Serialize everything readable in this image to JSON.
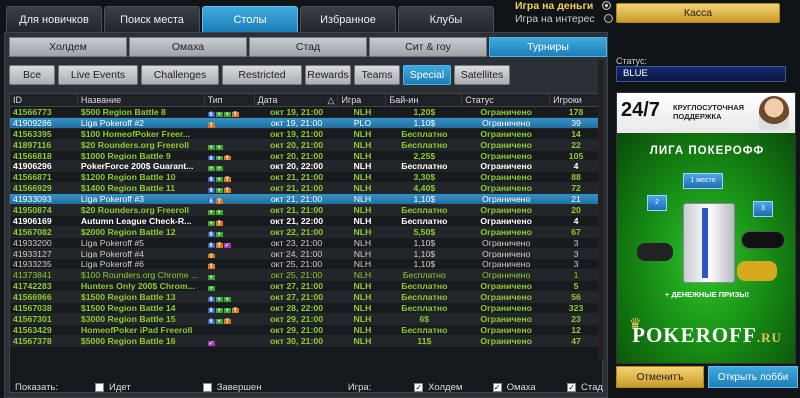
{
  "top_tabs": [
    "Для новичков",
    "Поиск места",
    "Столы",
    "Избранное",
    "Клубы"
  ],
  "active_top_tab": 2,
  "mode": {
    "real": "Игра на деньги",
    "play": "Игра на интерес"
  },
  "game_tabs": [
    "Холдем",
    "Омаха",
    "Стад",
    "Сит & гоу",
    "Турниры"
  ],
  "active_game_tab": 4,
  "filters": [
    "Все",
    "Live Events",
    "Challenges",
    "Restricted",
    "Rewards",
    "Teams",
    "Special",
    "Satellites"
  ],
  "active_filter": 6,
  "columns": {
    "id": "ID",
    "name": "Название",
    "type": "Тип",
    "date": "Дата",
    "sort": "△",
    "game": "Игра",
    "buyin": "Бай-ин",
    "status": "Статус",
    "players": "Игроки"
  },
  "rows": [
    {
      "id": "41566773",
      "name": "$500 Region Battle  8",
      "icons": "b g g o",
      "date": "окт 19, 21:00",
      "game": "NLH",
      "buyin": "1,20$",
      "status": "Ограничено",
      "players": "178",
      "style": "green"
    },
    {
      "id": "41909286",
      "name": "Liga Pokeroff #2",
      "icons": "o",
      "date": "окт 19, 21:00",
      "game": "PLO",
      "buyin": "1,10$",
      "status": "Ограничено",
      "players": "39",
      "style": "sel"
    },
    {
      "id": "41563395",
      "name": "$100 HomeofPoker Freer...",
      "icons": "",
      "date": "окт 19, 21:00",
      "game": "NLH",
      "buyin": "Бесплатно",
      "status": "Ограничено",
      "players": "14",
      "style": "green"
    },
    {
      "id": "41897116",
      "name": "$20 Rounders.org Freeroll",
      "icons": "g g",
      "date": "окт 20, 21:00",
      "game": "NLH",
      "buyin": "Бесплатно",
      "status": "Ограничено",
      "players": "22",
      "style": "green"
    },
    {
      "id": "41566818",
      "name": "$1000 Region Battle 9",
      "icons": "b g o",
      "date": "окт 20, 21:00",
      "game": "NLH",
      "buyin": "2,25$",
      "status": "Ограничено",
      "players": "105",
      "style": "green"
    },
    {
      "id": "41906296",
      "name": "PokerForce 200$ Guarant...",
      "icons": "g g",
      "date": "окт 20, 22:00",
      "game": "NLH",
      "buyin": "Бесплатно",
      "status": "Ограничено",
      "players": "4",
      "style": "white"
    },
    {
      "id": "41566871",
      "name": "$1200 Region Battle 10",
      "icons": "b g o",
      "date": "окт 21, 21:00",
      "game": "NLH",
      "buyin": "3,30$",
      "status": "Ограничено",
      "players": "88",
      "style": "green"
    },
    {
      "id": "41566929",
      "name": "$1400 Region Battle 11",
      "icons": "b g o",
      "date": "окт 21, 21:00",
      "game": "NLH",
      "buyin": "4,40$",
      "status": "Ограничено",
      "players": "72",
      "style": "green"
    },
    {
      "id": "41933093",
      "name": "Liga Pokeroff #3",
      "icons": "b o",
      "date": "окт 21, 21:00",
      "game": "NLH",
      "buyin": "1,10$",
      "status": "Ограничено",
      "players": "21",
      "style": "sel"
    },
    {
      "id": "41950874",
      "name": "$20 Rounders.org Freeroll",
      "icons": "g g",
      "date": "окт 21, 21:00",
      "game": "NLH",
      "buyin": "Бесплатно",
      "status": "Ограничено",
      "players": "20",
      "style": "green"
    },
    {
      "id": "41906169",
      "name": "Autumn League Check-R...",
      "icons": "g o",
      "date": "окт 21, 22:00",
      "game": "NLH",
      "buyin": "Бесплатно",
      "status": "Ограничено",
      "players": "4",
      "style": "white"
    },
    {
      "id": "41567082",
      "name": "$2000 Region Battle 12",
      "icons": "b g",
      "date": "окт 22, 21:00",
      "game": "NLH",
      "buyin": "5,50$",
      "status": "Ограничено",
      "players": "67",
      "style": "green"
    },
    {
      "id": "41933200",
      "name": "Liga Pokeroff #5",
      "icons": "b o p",
      "date": "окт 23, 21:00",
      "game": "NLH",
      "buyin": "1,10$",
      "status": "Ограничено",
      "players": "3",
      "style": "gray"
    },
    {
      "id": "41933127",
      "name": "Liga Pokeroff #4",
      "icons": "o",
      "date": "окт 24, 21:00",
      "game": "NLH",
      "buyin": "1,10$",
      "status": "Ограничено",
      "players": "3",
      "style": "gray"
    },
    {
      "id": "41933235",
      "name": "Liga Pokeroff #6",
      "icons": "o",
      "date": "окт 25, 21:00",
      "game": "NLH",
      "buyin": "1,10$",
      "status": "Ограничено",
      "players": "3",
      "style": "gray"
    },
    {
      "id": "41373841",
      "name": "$100 Rounders.org Chrome ...",
      "icons": "g",
      "date": "окт 25, 21:00",
      "game": "NLH",
      "buyin": "Бесплатно",
      "status": "Ограничено",
      "players": "1",
      "style": "green dim"
    },
    {
      "id": "41742283",
      "name": "Hunters Only 200$ Chrom...",
      "icons": "g",
      "date": "окт 27, 21:00",
      "game": "NLH",
      "buyin": "Бесплатно",
      "status": "Ограничено",
      "players": "5",
      "style": "green"
    },
    {
      "id": "41566966",
      "name": "$1500 Region Battle 13",
      "icons": "b g g",
      "date": "окт 27, 21:00",
      "game": "NLH",
      "buyin": "Бесплатно",
      "status": "Ограничено",
      "players": "56",
      "style": "green"
    },
    {
      "id": "41567038",
      "name": "$1500 Region Battle 14",
      "icons": "b g g o",
      "date": "окт 28, 22:00",
      "game": "NLH",
      "buyin": "Бесплатно",
      "status": "Ограничено",
      "players": "323",
      "style": "green"
    },
    {
      "id": "41567301",
      "name": "$3000 Region Battle 15",
      "icons": "b g o",
      "date": "окт 29, 21:00",
      "game": "NLH",
      "buyin": "6$",
      "status": "Ограничено",
      "players": "23",
      "style": "green"
    },
    {
      "id": "41563429",
      "name": "HomeofPoker iPad Freeroll",
      "icons": "",
      "date": "окт 29, 21:00",
      "game": "NLH",
      "buyin": "Бесплатно",
      "status": "Ограничено",
      "players": "12",
      "style": "green"
    },
    {
      "id": "41567378",
      "name": "$5000 Region Battle 16",
      "icons": "p",
      "date": "окт 30, 21:00",
      "game": "NLH",
      "buyin": "11$",
      "status": "Ограничено",
      "players": "47",
      "style": "green"
    }
  ],
  "footer": {
    "show": "Показать:",
    "running": "Идет",
    "finished": "Завершен",
    "game": "Игра:",
    "holdem": "Холдем",
    "omaha": "Омаха",
    "stud": "Стад"
  },
  "side": {
    "cashier": "Касса",
    "status_label": "Статус:",
    "status_value": "BLUE",
    "ad_247": "24/7",
    "ad_support": "КРУГЛОСУТОЧНАЯ ПОДДЕРЖКА",
    "ad_title": "ЛИГА ПОКЕРОФФ",
    "place1": "1 место",
    "place2": "2",
    "place3": "3",
    "ad_money": "+ ДЕНЕЖНЫЕ ПРИЗЫ!",
    "logo": "POKEROFF",
    "logo_ru": ".RU",
    "cancel": "Отменитъ",
    "open_lobby": "Открыть лобби"
  }
}
